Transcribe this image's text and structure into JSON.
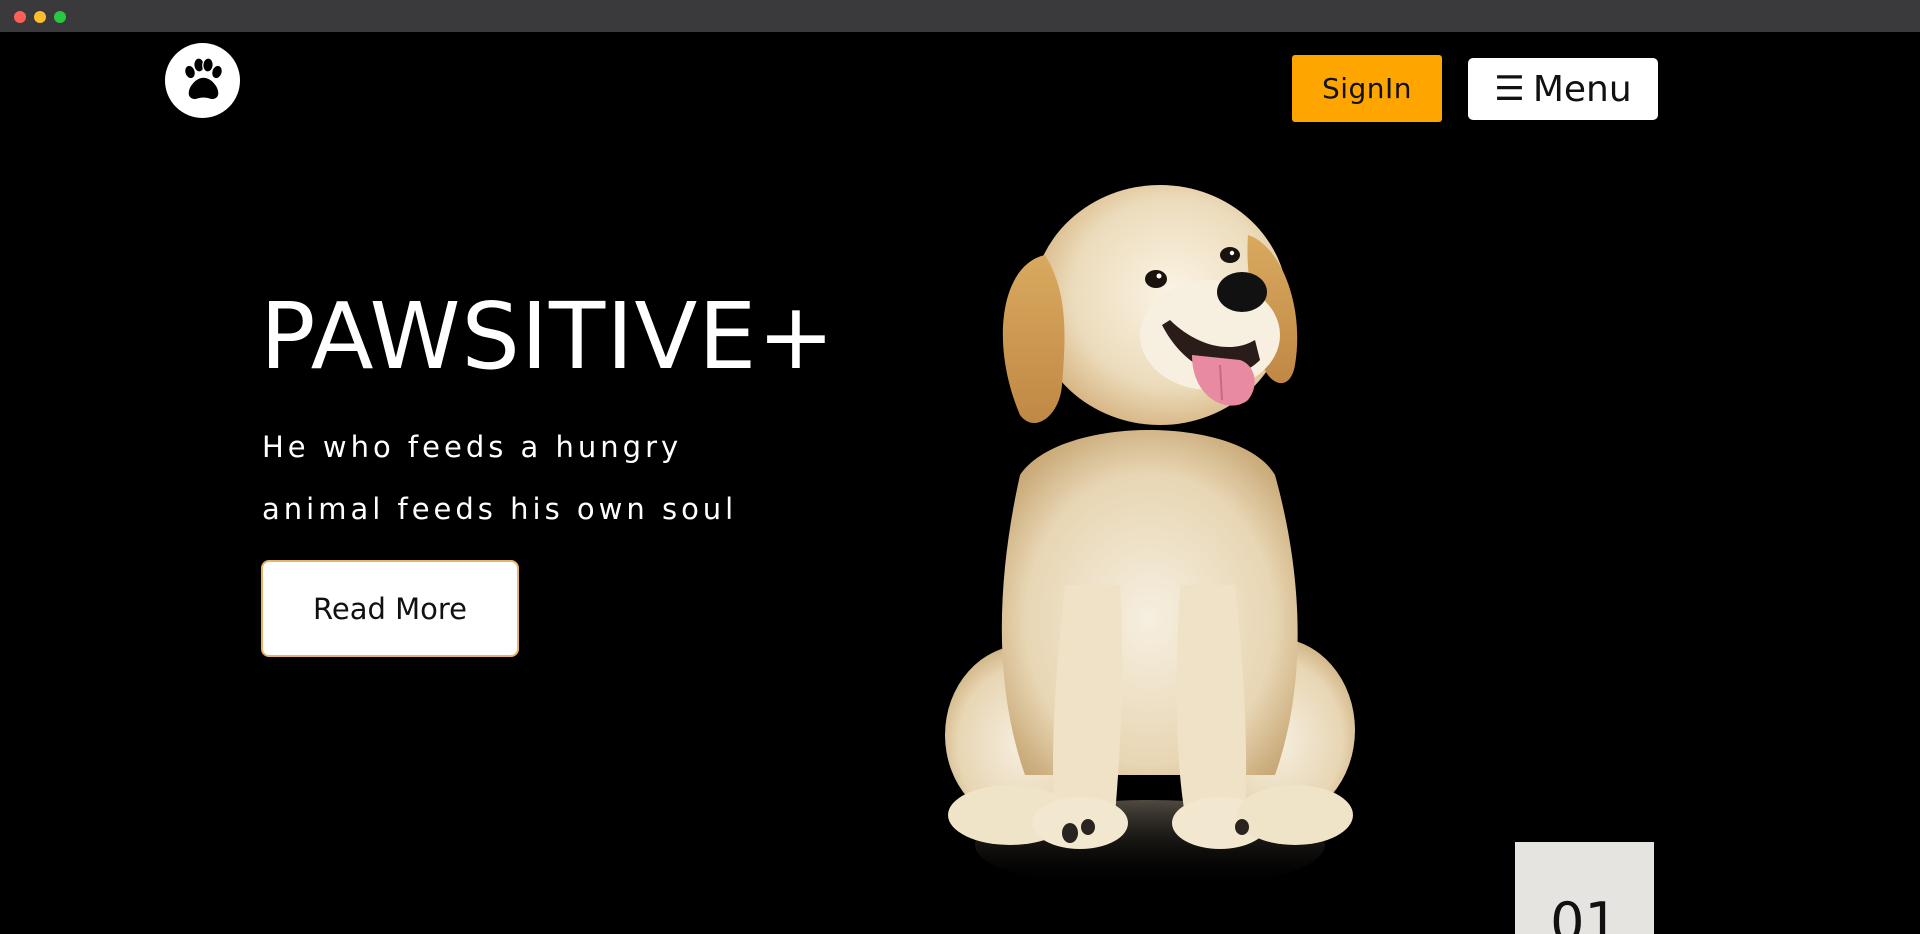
{
  "header": {
    "logo_icon": "paw-icon",
    "signin_label": "SignIn",
    "menu_icon": "hamburger-icon",
    "menu_glyph": "☰",
    "menu_label": "Menu"
  },
  "hero": {
    "title": "PAWSITIVE+",
    "tagline_line1": "He who feeds a hungry",
    "tagline_line2": "animal feeds his own soul",
    "read_more_label": "Read More",
    "image_subject": "puppy"
  },
  "slider": {
    "current_slide": "01"
  },
  "colors": {
    "background": "#000000",
    "accent": "#ffa500",
    "button_bg": "#ffffff",
    "slide_badge_bg": "#e6e4e1"
  }
}
